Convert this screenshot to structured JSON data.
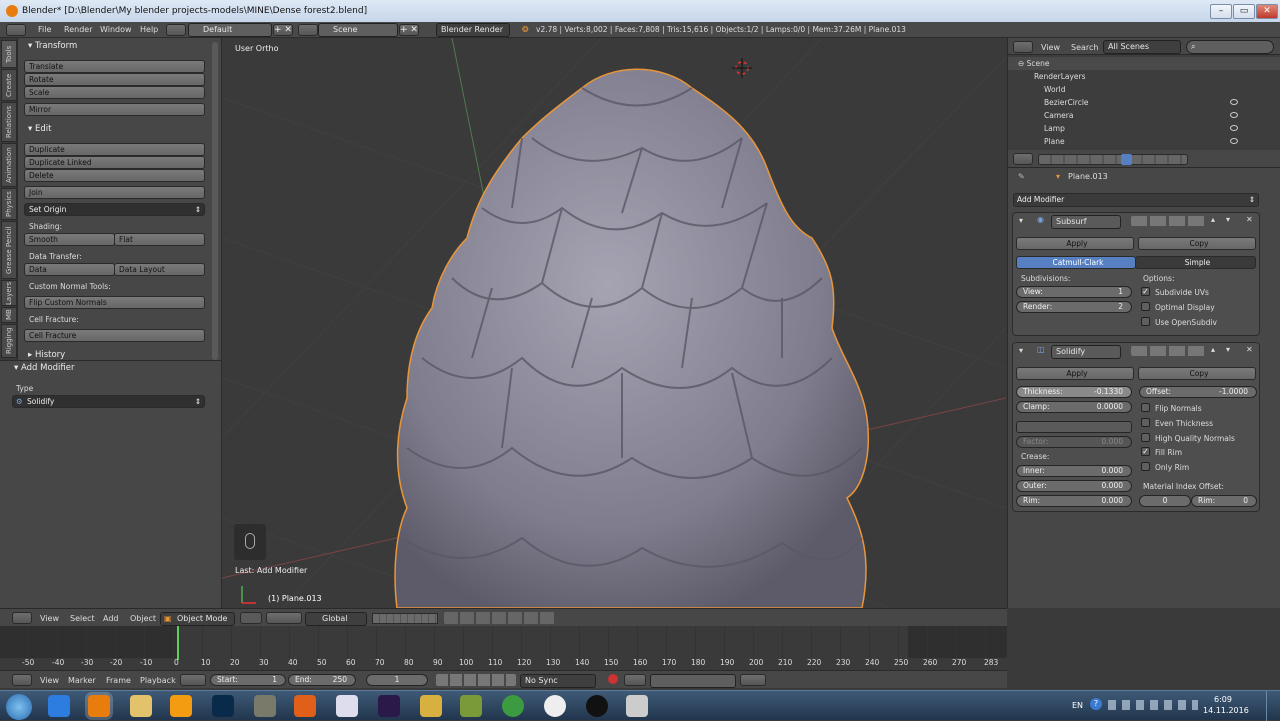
{
  "window": {
    "title": "Blender* [D:\\Blender\\My blender projects-models\\MINE\\Dense forest2.blend]"
  },
  "topbar": {
    "menus": [
      "File",
      "Render",
      "Window",
      "Help"
    ],
    "screen_layout": "Default",
    "scene": "Scene",
    "render_engine": "Blender Render",
    "stats": "v2.78 | Verts:8,002 | Faces:7,808 | Tris:15,616 | Objects:1/2 | Lamps:0/0 | Mem:37.26M | Plane.013"
  },
  "toolshelf": {
    "tabs": [
      "Tools",
      "Create",
      "Relations",
      "Animation",
      "Physics",
      "Grease Pencil",
      "Layers",
      "MB",
      "Rigging"
    ],
    "transform": {
      "title": "Transform",
      "translate": "Translate",
      "rotate": "Rotate",
      "scale": "Scale",
      "mirror": "Mirror"
    },
    "edit": {
      "title": "Edit",
      "duplicate": "Duplicate",
      "duplicate_linked": "Duplicate Linked",
      "delete": "Delete",
      "join": "Join",
      "set_origin": "Set Origin",
      "shading_label": "Shading:",
      "smooth": "Smooth",
      "flat": "Flat",
      "data_transfer_label": "Data Transfer:",
      "data": "Data",
      "data_layout": "Data Layout",
      "custom_normal_label": "Custom Normal Tools:",
      "flip_custom_normals": "Flip Custom Normals",
      "cell_fracture_label": "Cell Fracture:",
      "cell_fracture": "Cell Fracture"
    },
    "history": {
      "title": "History"
    },
    "operator": {
      "title": "Add Modifier",
      "type_label": "Type",
      "type_value": "Solidify"
    }
  },
  "viewport": {
    "view_label": "User Ortho",
    "last_operator": "Last: Add Modifier",
    "object_label": "(1) Plane.013",
    "header": {
      "menus": [
        "View",
        "Select",
        "Add",
        "Object"
      ],
      "mode": "Object Mode",
      "orientation": "Global"
    }
  },
  "outliner": {
    "menus": [
      "View",
      "Search"
    ],
    "filter": "All Scenes",
    "items": [
      "Scene",
      "RenderLayers",
      "World",
      "BezierCircle",
      "Camera",
      "Lamp",
      "Plane"
    ]
  },
  "properties": {
    "breadcrumb": "Plane.013",
    "add_modifier": "Add Modifier",
    "subsurf": {
      "name": "Subsurf",
      "apply": "Apply",
      "copy": "Copy",
      "algo_active": "Catmull-Clark",
      "algo_other": "Simple",
      "subdivisions_label": "Subdivisions:",
      "view_label": "View:",
      "view_value": "1",
      "render_label": "Render:",
      "render_value": "2",
      "options_label": "Options:",
      "subdivide_uvs": "Subdivide UVs",
      "optimal_display": "Optimal Display",
      "use_opensubdiv": "Use OpenSubdiv"
    },
    "solidify": {
      "name": "Solidify",
      "apply": "Apply",
      "copy": "Copy",
      "thickness_label": "Thickness:",
      "thickness_value": "-0.1330",
      "offset_label": "Offset:",
      "offset_value": "-1.0000",
      "clamp_label": "Clamp:",
      "clamp_value": "0.0000",
      "factor_label": "Factor:",
      "factor_value": "0.000",
      "crease_label": "Crease:",
      "inner_label": "Inner:",
      "inner_value": "0.000",
      "outer_label": "Outer:",
      "outer_value": "0.000",
      "rim_label": "Rim:",
      "rim_value": "0.000",
      "flip_normals": "Flip Normals",
      "even_thickness": "Even Thickness",
      "high_quality_normals": "High Quality Normals",
      "fill_rim": "Fill Rim",
      "only_rim": "Only Rim",
      "material_index_offset": "Material Index Offset:",
      "mat_value": "0",
      "mat_rim_label": "Rim:",
      "mat_rim_value": "0"
    }
  },
  "timeline": {
    "ticks": [
      "-50",
      "-40",
      "-30",
      "-20",
      "-10",
      "0",
      "10",
      "20",
      "30",
      "40",
      "50",
      "60",
      "70",
      "80",
      "90",
      "100",
      "110",
      "120",
      "130",
      "140",
      "150",
      "160",
      "170",
      "180",
      "190",
      "200",
      "210",
      "220",
      "230",
      "240",
      "250",
      "260",
      "270",
      "283"
    ],
    "current_frame": "1",
    "menus": [
      "View",
      "Marker",
      "Frame",
      "Playback"
    ],
    "start_label": "Start:",
    "start_value": "1",
    "end_label": "End:",
    "end_value": "250",
    "sync": "No Sync"
  },
  "taskbar": {
    "lang": "EN",
    "time": "6:09",
    "date": "14.11.2016"
  },
  "colors": {
    "selection_outline": "#e8963a",
    "active_blue": "#5680c2",
    "object_color": "#8e8c9c"
  }
}
